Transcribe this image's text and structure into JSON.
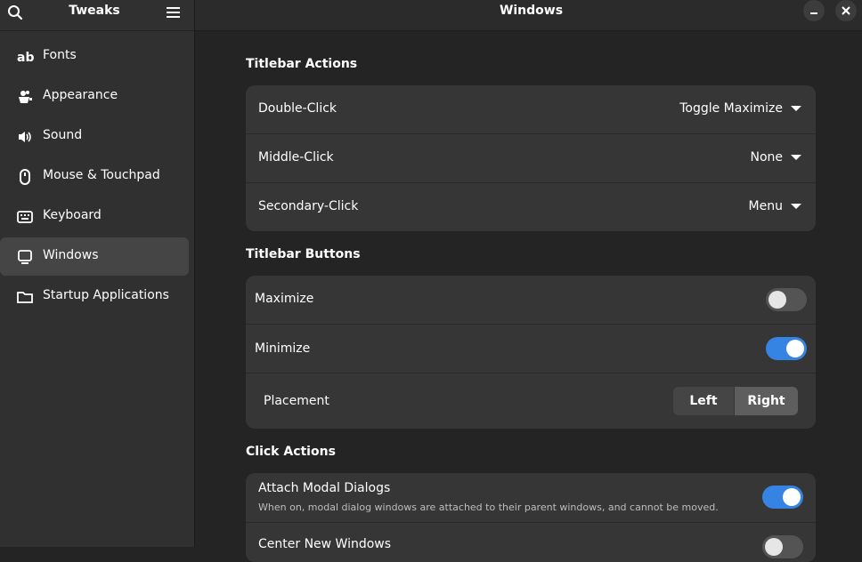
{
  "sidebar": {
    "title": "Tweaks",
    "search_icon": "search-icon",
    "menu_icon": "hamburger-menu-icon",
    "items": [
      {
        "label": "Fonts",
        "icon": "fonts-icon"
      },
      {
        "label": "Appearance",
        "icon": "appearance-icon"
      },
      {
        "label": "Sound",
        "icon": "speaker-icon"
      },
      {
        "label": "Mouse & Touchpad",
        "icon": "mouse-icon"
      },
      {
        "label": "Keyboard",
        "icon": "keyboard-icon"
      },
      {
        "label": "Windows",
        "icon": "monitor-icon",
        "active": true
      },
      {
        "label": "Startup Applications",
        "icon": "folder-icon"
      }
    ]
  },
  "header": {
    "title": "Windows",
    "minimize_icon": "minimize-icon",
    "close_icon": "close-icon"
  },
  "titlebar_actions": {
    "title": "Titlebar Actions",
    "rows": [
      {
        "label": "Double-Click",
        "value": "Toggle Maximize"
      },
      {
        "label": "Middle-Click",
        "value": "None"
      },
      {
        "label": "Secondary-Click",
        "value": "Menu"
      }
    ]
  },
  "titlebar_buttons": {
    "title": "Titlebar Buttons",
    "maximize": {
      "label": "Maximize",
      "on": false
    },
    "minimize": {
      "label": "Minimize",
      "on": true
    },
    "placement": {
      "label": "Placement",
      "options": [
        "Left",
        "Right"
      ],
      "selected": "Right"
    }
  },
  "click_actions": {
    "title": "Click Actions",
    "attach_modal": {
      "label": "Attach Modal Dialogs",
      "description": "When on, modal dialog windows are attached to their parent windows, and cannot be moved.",
      "on": true
    },
    "center_new": {
      "label": "Center New Windows",
      "on": false
    }
  },
  "colors": {
    "accent": "#3584e4",
    "background": "#242424",
    "sidebar": "#303030",
    "card": "#363636"
  }
}
